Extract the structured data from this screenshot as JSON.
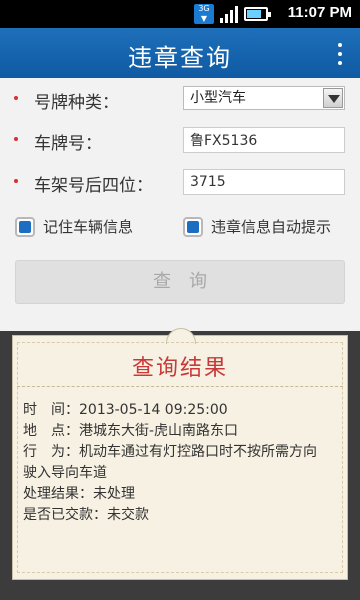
{
  "status_bar": {
    "network_icon": "3g-network-icon",
    "time": "11:07 PM"
  },
  "header": {
    "title": "违章查询",
    "menu_icon": "overflow-menu-icon"
  },
  "form": {
    "plate_type": {
      "label": "号牌种类：",
      "value": "小型汽车"
    },
    "plate_number": {
      "label": "车牌号：",
      "value": "鲁FX5136"
    },
    "vin_last4": {
      "label": "车架号后四位：",
      "value": "3715"
    }
  },
  "options": {
    "remember_vehicle": {
      "label": "记住车辆信息",
      "checked": true
    },
    "auto_notify": {
      "label": "违章信息自动提示",
      "checked": true
    }
  },
  "query_button": {
    "label": "查询"
  },
  "result": {
    "title": "查询结果",
    "time": "时　间：2013-05-14 09:25:00",
    "location": "地　点：港城东大街-虎山南路东口",
    "behavior_line1": "行　为：机动车通过有灯控路口时不按所需方向",
    "behavior_line2": "驶入导向车道",
    "handling_status": "处理结果：未处理",
    "payment_status": "是否已交款：未交款"
  },
  "colors": {
    "header": "#1565b5",
    "accent": "#1b6ec2",
    "result_title": "#c83a3a",
    "required_dot": "#d62f2f"
  }
}
